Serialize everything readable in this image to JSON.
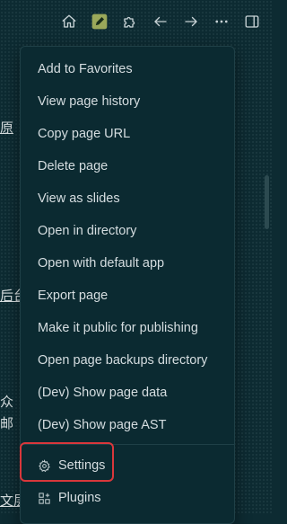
{
  "toolbar": {
    "icons": [
      "home-icon",
      "edit-page-icon",
      "puzzle-icon",
      "arrow-left-icon",
      "arrow-right-icon",
      "more-icon",
      "sidebar-toggle-icon"
    ]
  },
  "background_text": {
    "frag1": "原",
    "frag2": "后台",
    "frag3": "众",
    "frag4": "邮",
    "frag5": "文层"
  },
  "menu": {
    "items": [
      "Add to Favorites",
      "View page history",
      "Copy page URL",
      "Delete page",
      "View as slides",
      "Open in directory",
      "Open with default app",
      "Export page",
      "Make it public for publishing",
      "Open page backups directory",
      "(Dev) Show page data",
      "(Dev) Show page AST"
    ],
    "settings_label": "Settings",
    "plugins_label": "Plugins"
  },
  "colors": {
    "background": "#0d2b32",
    "menu_background": "#0b2a31",
    "highlight": "#d9373b",
    "edit_icon_accent": "#9aa85a"
  }
}
